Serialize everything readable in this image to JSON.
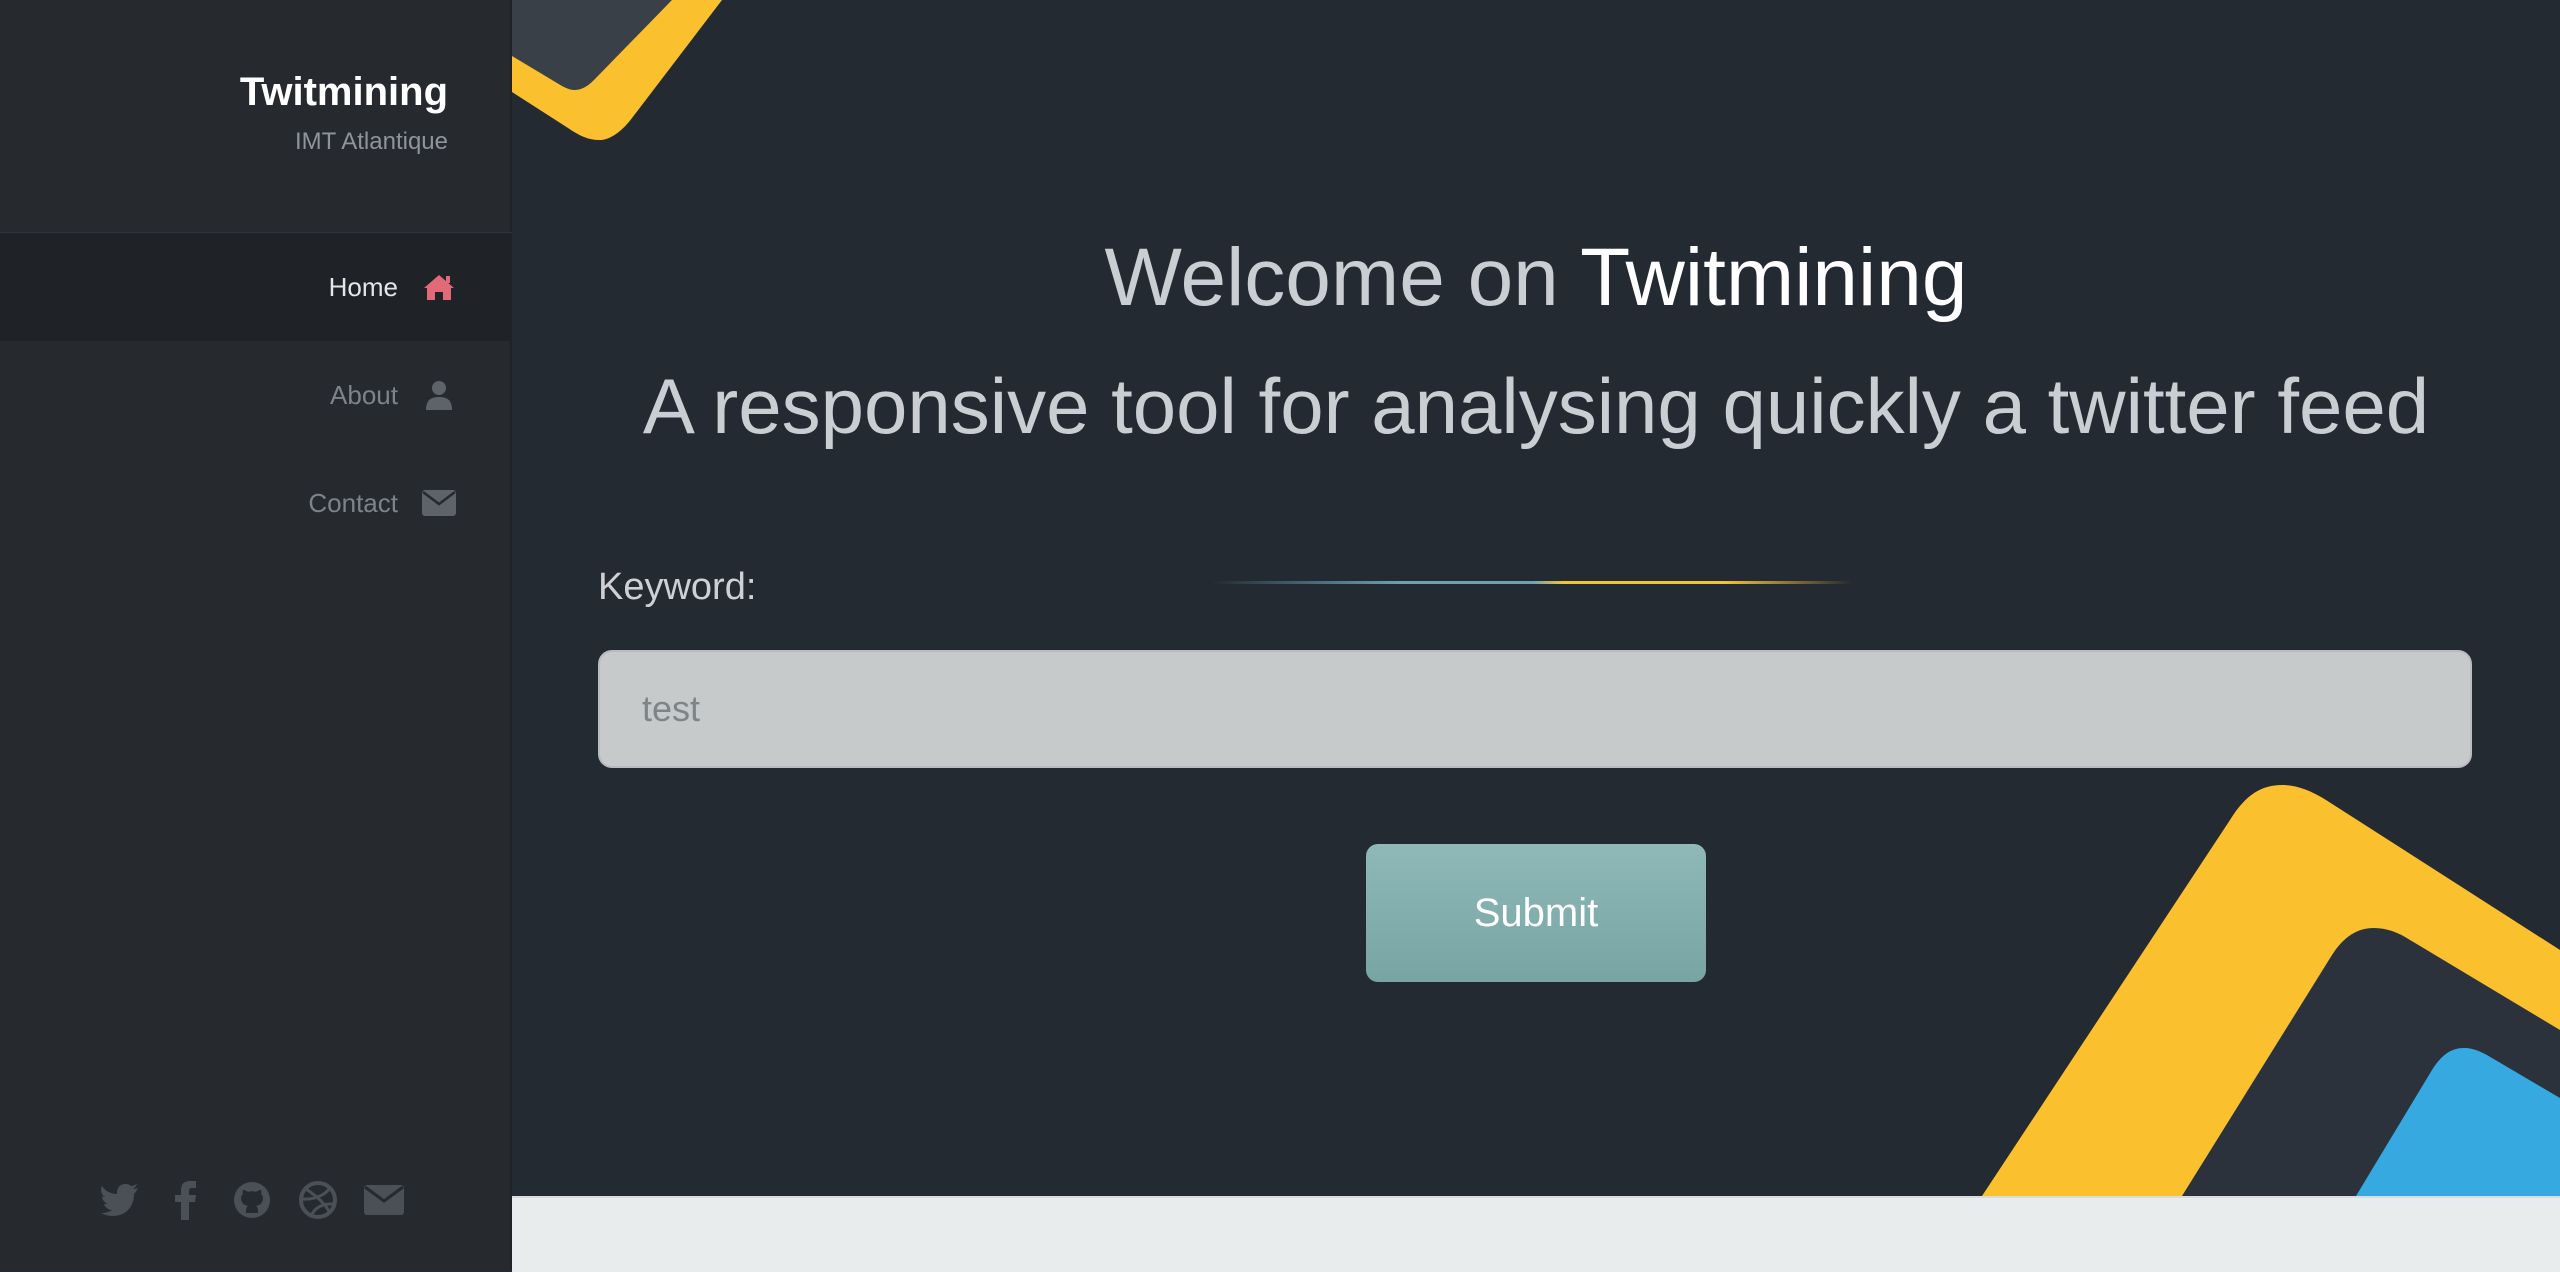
{
  "sidebar": {
    "brand_title": "Twitmining",
    "brand_subtitle": "IMT Atlantique",
    "nav": [
      {
        "label": "Home",
        "icon": "home-icon"
      },
      {
        "label": "About",
        "icon": "user-icon"
      },
      {
        "label": "Contact",
        "icon": "envelope-icon"
      }
    ],
    "social_icons": [
      "twitter-icon",
      "facebook-icon",
      "github-icon",
      "dribbble-icon",
      "envelope-icon"
    ]
  },
  "main": {
    "heading_prefix": "Welcome on",
    "heading_accent": "Twitmining",
    "subheading": "A responsive tool for analysing quickly a twitter feed",
    "keyword_label": "Keyword:",
    "keyword_value": "test",
    "submit_label": "Submit"
  },
  "colors": {
    "accent_home": "#e06a7a",
    "deco_yellow": "#fbc02d",
    "deco_blue": "#36a9e1",
    "button": "#82acac",
    "background": "#242a31"
  }
}
